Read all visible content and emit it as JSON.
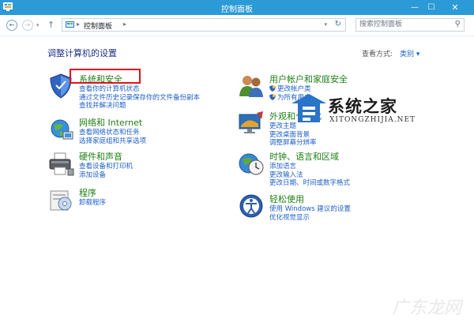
{
  "window": {
    "title": "控制面板",
    "minimize": "—",
    "maximize": "☐",
    "close": "✕"
  },
  "nav": {
    "back": "←",
    "forward": "→",
    "dropdown": "▾",
    "up": "↑",
    "address_sep": "▸",
    "breadcrumb": "控制面板",
    "breadcrumb_sep": "▸",
    "address_dropdown": "▾",
    "refresh": "↻",
    "search_placeholder": "搜索控制面板",
    "search_icon": "⚲"
  },
  "page": {
    "heading": "调整计算机的设置",
    "view_by_label": "查看方式:",
    "view_by_value": "类别 ▾"
  },
  "categories_left": [
    {
      "icon": "shield-icon",
      "title": "系统和安全",
      "links": [
        "查看你的计算机状态",
        "通过文件历史记录保存你的文件备份副本",
        "查找并解决问题"
      ]
    },
    {
      "icon": "network-icon",
      "title": "网络和 Internet",
      "links": [
        "查看网络状态和任务",
        "选择家庭组和共享选项"
      ]
    },
    {
      "icon": "printer-icon",
      "title": "硬件和声音",
      "links": [
        "查看设备和打印机",
        "添加设备"
      ]
    },
    {
      "icon": "programs-icon",
      "title": "程序",
      "links": [
        "卸载程序"
      ]
    }
  ],
  "categories_right": [
    {
      "icon": "users-icon",
      "title": "用户帐户和家庭安全",
      "links": [
        "更改帐户类",
        "为所有用户"
      ]
    },
    {
      "icon": "appearance-icon",
      "title": "外观和个性化",
      "links": [
        "更改主题",
        "更改桌面背景",
        "调整屏幕分辨率"
      ]
    },
    {
      "icon": "clock-globe-icon",
      "title": "时钟、语言和区域",
      "links": [
        "添加语言",
        "更改输入法",
        "更改日期、时间或数字格式"
      ]
    },
    {
      "icon": "ease-access-icon",
      "title": "轻松使用",
      "links": [
        "使用 Windows 建议的设置",
        "优化视觉显示"
      ]
    }
  ],
  "watermark": {
    "main": "系统之家",
    "sub": "XITONGZHIJIA.NET",
    "corner": "广东龙网"
  },
  "colors": {
    "titlebar": "#2b9ad6",
    "category_title": "#1e7f14",
    "link": "#1e5fc8",
    "heading": "#1e3287",
    "highlight_box": "#e0121b"
  }
}
